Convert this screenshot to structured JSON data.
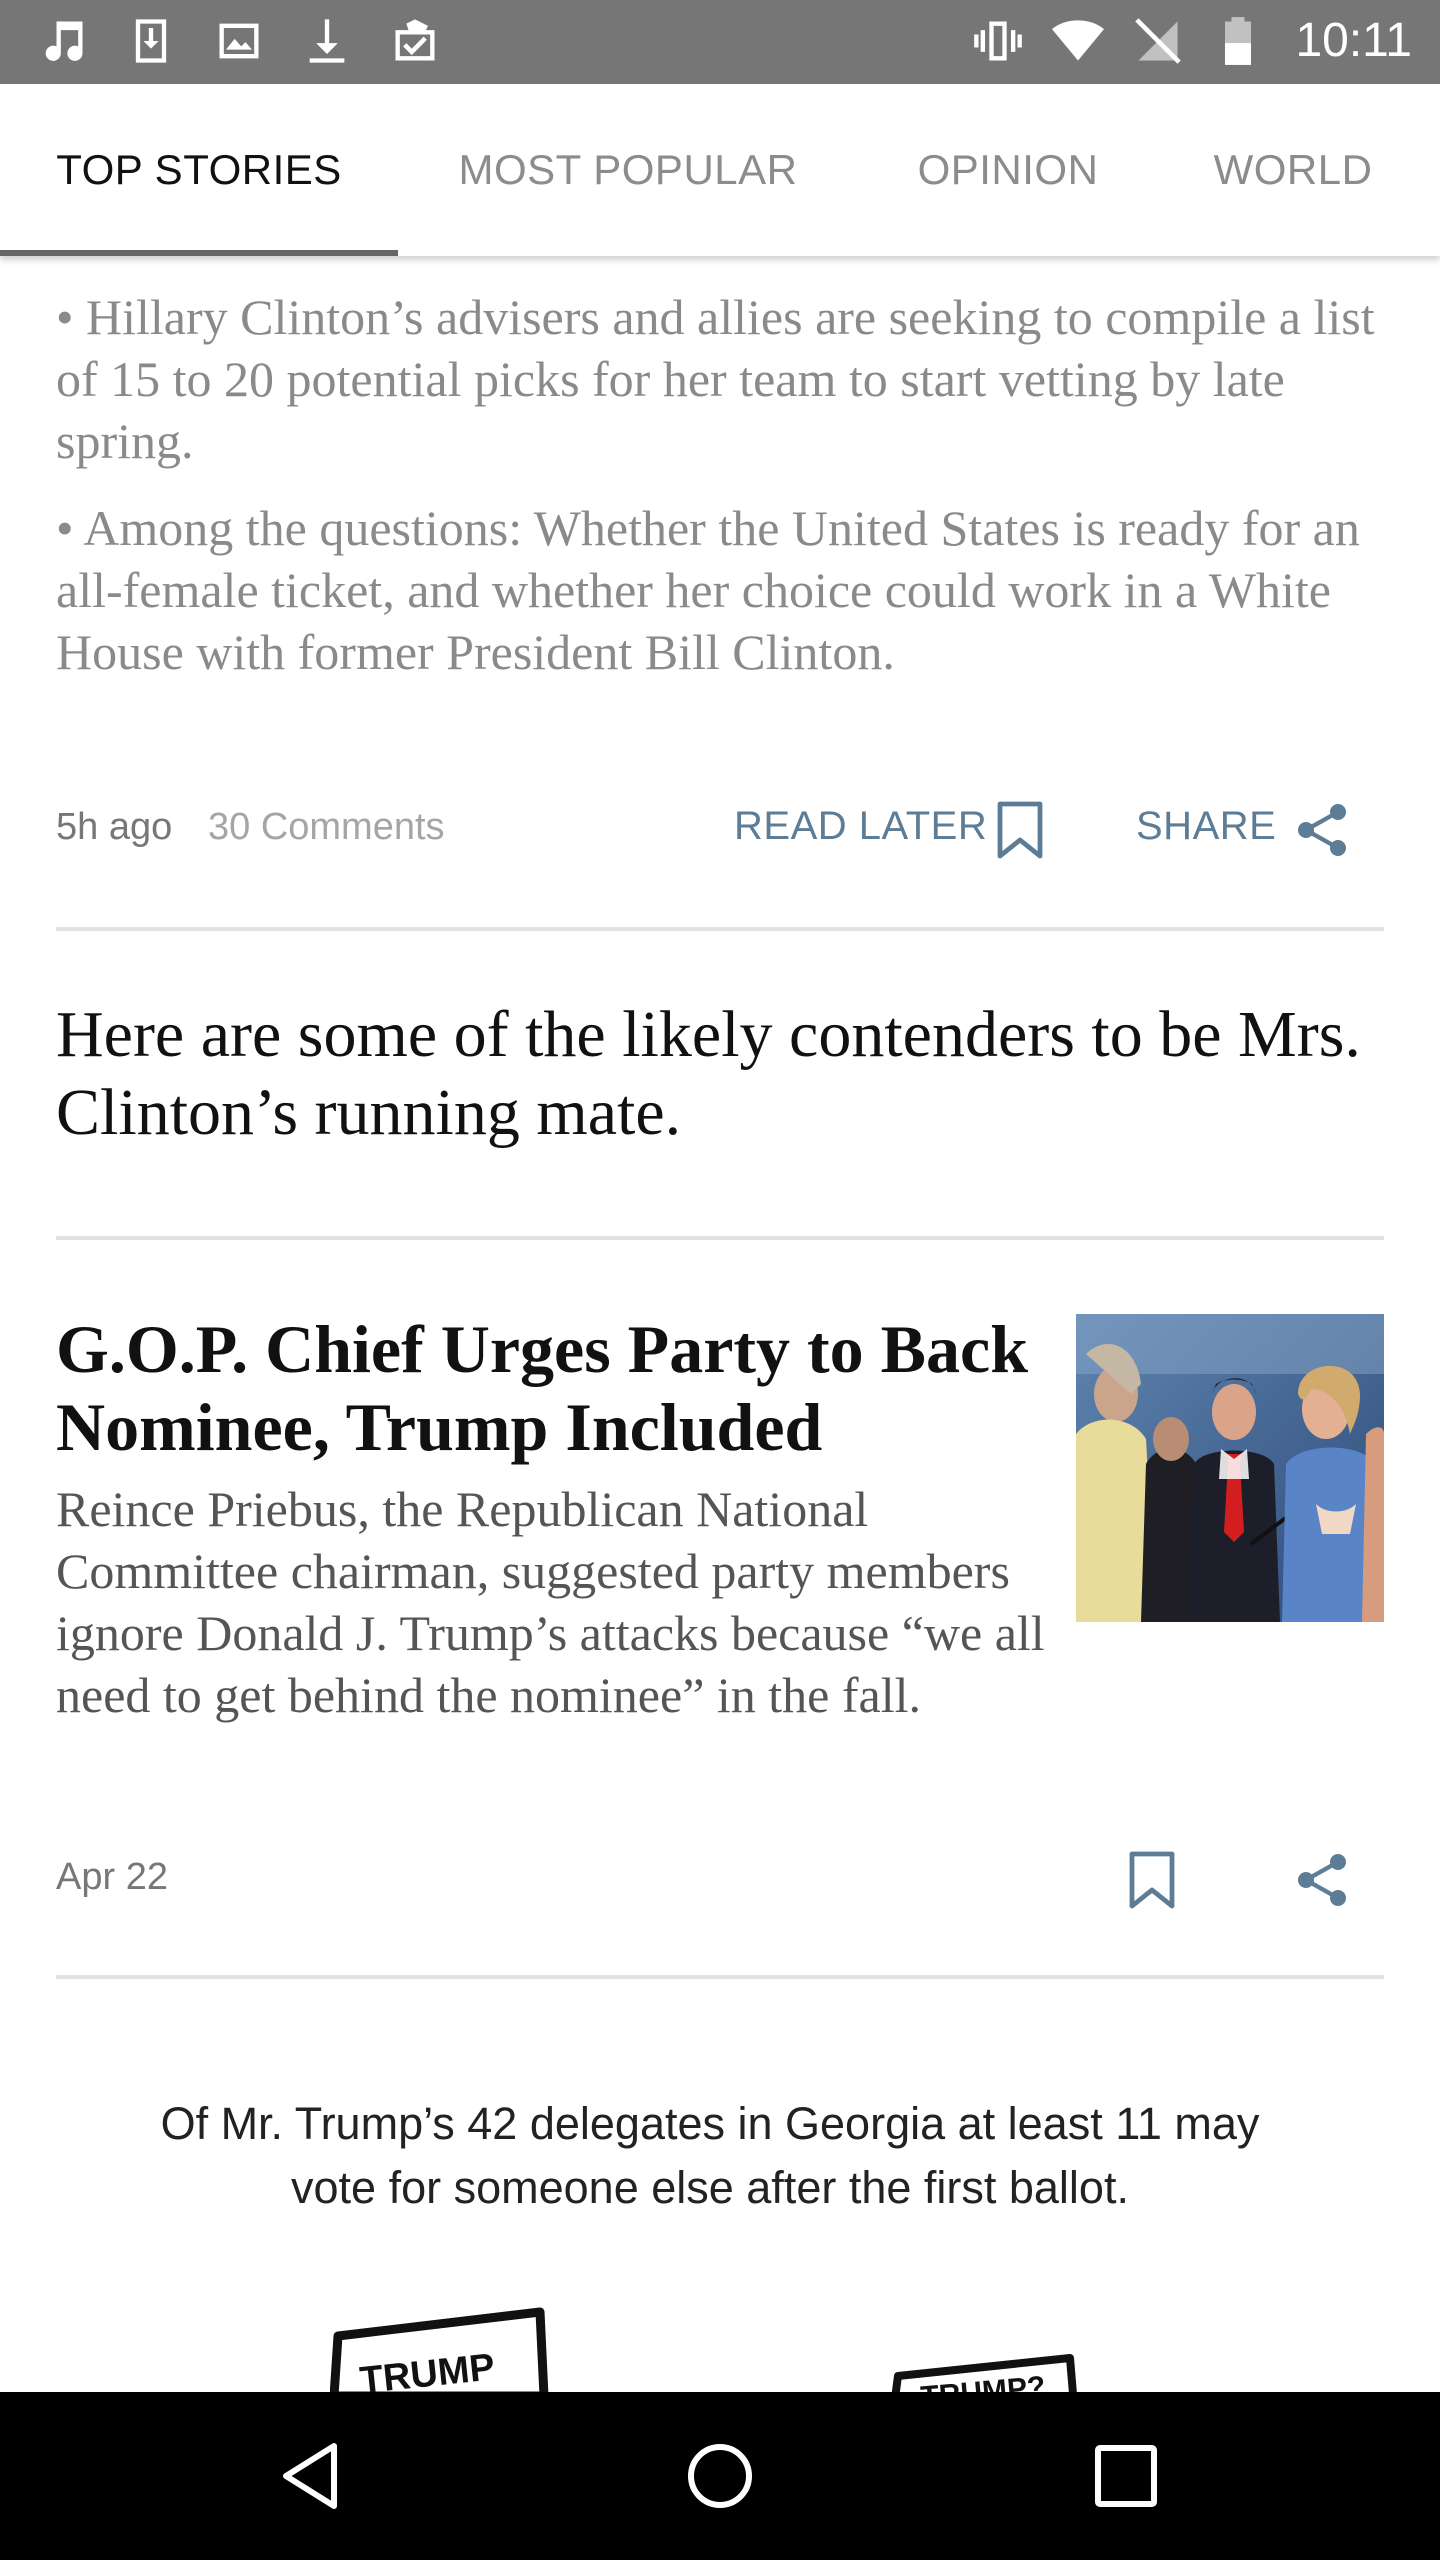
{
  "status_bar": {
    "time": "10:11",
    "left_icons": [
      "music-icon",
      "download-box-icon",
      "image-icon",
      "download-icon",
      "briefcase-check-icon"
    ],
    "right_icons": [
      "vibrate-icon",
      "wifi-icon",
      "no-signal-icon",
      "battery-icon"
    ]
  },
  "tabs": [
    {
      "label": "TOP STORIES",
      "active": true
    },
    {
      "label": "MOST POPULAR",
      "active": false
    },
    {
      "label": "OPINION",
      "active": false
    },
    {
      "label": "WORLD",
      "active": false
    }
  ],
  "story1": {
    "bullets": [
      "Hillary Clinton’s advisers and allies are seeking to compile a list of 15 to 20 potential picks for her team to start vetting by late spring.",
      "Among the questions: Whether the United States is ready for an all-female ticket, and whether her choice could work in a White House with former President Bill Clinton."
    ],
    "time_ago": "5h ago",
    "comments": "30 Comments",
    "read_later": "READ LATER",
    "share": "SHARE"
  },
  "story2": {
    "headline": "Here are some of the likely contenders to be Mrs. Clinton’s running mate."
  },
  "story3": {
    "headline": "G.O.P. Chief Urges Party to Back Nominee, Trump Included",
    "summary": "Reince Priebus, the Republican National Committee chairman, suggested party members ignore Donald J. Trump’s attacks because “we all need to get behind the nominee” in the fall.",
    "date": "Apr 22"
  },
  "graphic": {
    "caption": "Of Mr. Trump’s 42 delegates in Georgia at least 11 may vote for someone else after the first ballot.",
    "sign1": "TRUMP",
    "sign2": "TRUMP?"
  },
  "colors": {
    "status_bar": "#767676",
    "action_blue": "#5d7d97",
    "nav_bar": "#000000"
  }
}
